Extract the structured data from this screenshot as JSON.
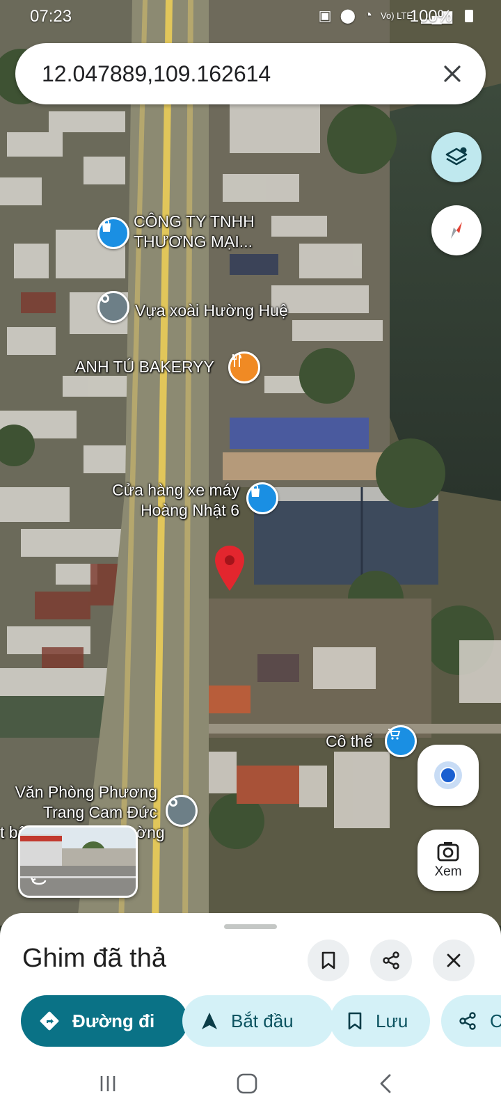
{
  "status_bar": {
    "time": "07:23",
    "network": "Vo) LTE",
    "battery": "100%"
  },
  "search": {
    "value": "12.047889,109.162614",
    "close_icon": "close-icon"
  },
  "map": {
    "labels": [
      {
        "id": "cong-ty",
        "lines": [
          "CÔNG TY TNHH",
          "THƯƠNG MẠI..."
        ],
        "icon": "shopping-bag-icon",
        "color": "#1a8fe3"
      },
      {
        "id": "vua-xoai",
        "lines": [
          "Vựa xoài Hường Huệ"
        ],
        "icon": "place-icon",
        "color": "#6d7f87"
      },
      {
        "id": "anh-tu",
        "lines": [
          "ANH TÚ BAKERYY"
        ],
        "icon": "restaurant-icon",
        "color": "#f08a24"
      },
      {
        "id": "cua-hang",
        "lines": [
          "Cửa hàng xe máy",
          "Hoàng Nhật 6"
        ],
        "icon": "shopping-bag-icon",
        "color": "#1a8fe3"
      },
      {
        "id": "co-the",
        "lines": [
          "Cô thể"
        ],
        "icon": "shopping-cart-icon",
        "color": "#1a8fe3"
      },
      {
        "id": "van-phong",
        "lines": [
          "Văn Phòng Phương",
          "Trang Cam Đức"
        ],
        "icon": "place-icon",
        "color": "#6d7f87"
      }
    ],
    "partial_label": "t bậ",
    "partial_label_2": "ờng",
    "dropped_pin_color": "#e3262e"
  },
  "controls": {
    "layers_icon": "layers-icon",
    "compass_icon": "compass-icon",
    "my_location_icon": "my-location-icon",
    "lens_label": "Xem"
  },
  "sheet": {
    "title": "Ghim đã thả",
    "actions": {
      "directions": "Đường đi",
      "start": "Bắt đầu",
      "save": "Lưu",
      "share": "C"
    }
  },
  "colors": {
    "accent": "#0a7286",
    "chip_bg": "#d4f1f7",
    "pin": "#e3262e"
  }
}
